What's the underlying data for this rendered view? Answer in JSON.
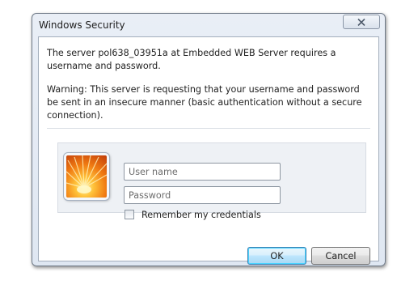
{
  "window": {
    "title": "Windows Security",
    "close_icon": "close-icon"
  },
  "message": {
    "line1": "The server pol638_03951a at Embedded WEB Server requires a username and password.",
    "warning": "Warning: This server is requesting that your username and password be sent in an insecure manner (basic authentication without a secure connection)."
  },
  "credentials": {
    "avatar_icon": "user-tile-flower-icon",
    "username": {
      "value": "",
      "placeholder": "User name"
    },
    "password": {
      "value": "",
      "placeholder": "Password"
    },
    "remember": {
      "label": "Remember my credentials",
      "checked": false
    }
  },
  "buttons": {
    "ok_label": "OK",
    "cancel_label": "Cancel"
  },
  "colors": {
    "default_button_border": "#3c7fb1",
    "default_button_glow": "#48d3ff",
    "dialog_frame": "#dfe7f2"
  }
}
